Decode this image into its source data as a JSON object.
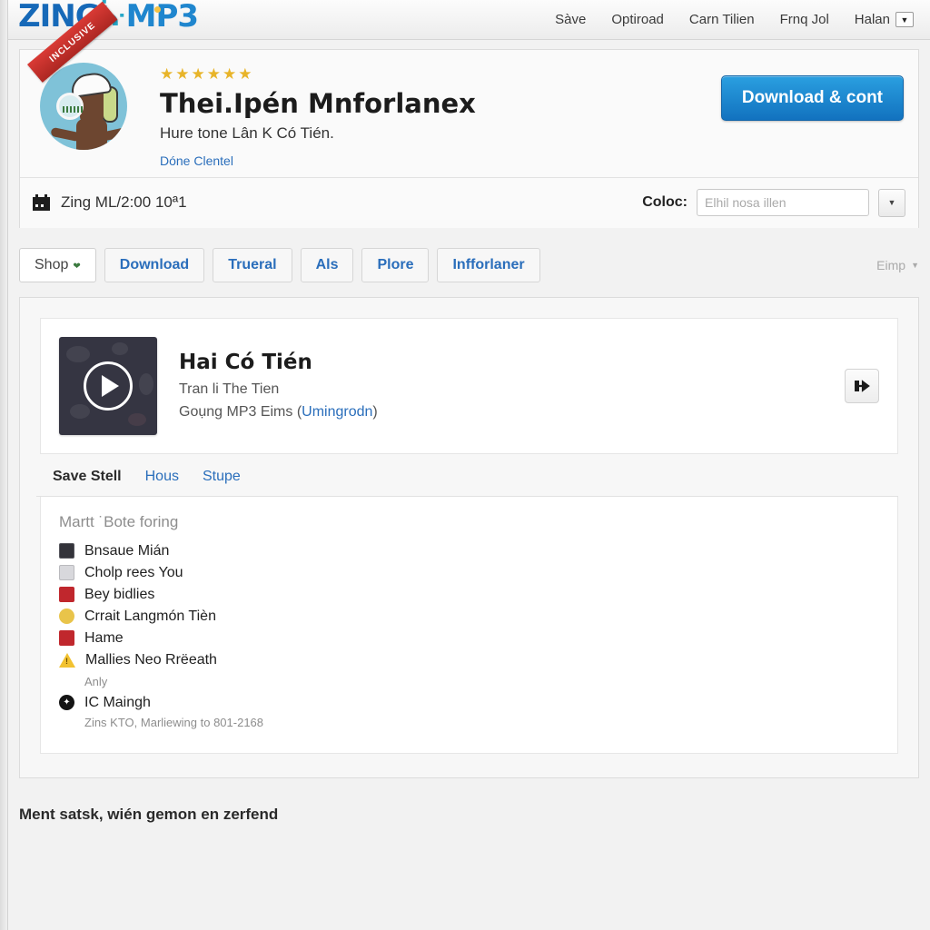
{
  "brand": {
    "part1": "ZING",
    "swoosh": "ᓾ",
    "part2": "MP3"
  },
  "topnav": {
    "items": [
      {
        "label": "Sàve"
      },
      {
        "label": "Optiroad"
      },
      {
        "label": "Carn Tilien"
      },
      {
        "label": "Frnq Jol"
      },
      {
        "label": "Halan"
      }
    ],
    "caret": "▼"
  },
  "hero": {
    "ribbon_label": "INCLUSIVE",
    "stars": "★★★★★★",
    "title": "Thei.Ipén Mnforlanex",
    "subtitle": "Hure tone Lân K Có Tién.",
    "link": "Dóne Clentel",
    "download_button": "Download & cont",
    "bar_text": "Zing ML/2:00 10ª1",
    "coloc_label": "Coloc:",
    "coloc_placeholder": "Elhil nosa illen",
    "coloc_value": "",
    "coloc_caret": "▼"
  },
  "tabs": {
    "items": [
      {
        "label": "Shop",
        "caret": "❤",
        "active": true
      },
      {
        "label": "Download",
        "active": false
      },
      {
        "label": "Trueral",
        "active": false
      },
      {
        "label": "Als",
        "active": false
      },
      {
        "label": "Plore",
        "active": false
      },
      {
        "label": "Infforlaner",
        "active": false
      }
    ],
    "right_label": "Eimp",
    "right_caret": "▼"
  },
  "song": {
    "title": "Hai Có Tién",
    "artist": "Tran li The Tien",
    "meta_prefix": "Goụng MP3 Eims (",
    "meta_link": "Umingrodn",
    "meta_suffix": ")",
    "action_icon": "sign-in-arrow"
  },
  "subtabs": [
    {
      "label": "Save Stell",
      "active": true
    },
    {
      "label": "Hous",
      "active": false
    },
    {
      "label": "Stupe",
      "active": false
    }
  ],
  "list": {
    "heading": "Martt ˙Bote foring",
    "items": [
      {
        "label": "Bnsaue Mián",
        "icon": "calculator-icon",
        "color": "#33333a"
      },
      {
        "label": "Cholp rees You",
        "icon": "disc-icon",
        "color": "#b9b9bd"
      },
      {
        "label": "Bey bidlies",
        "icon": "badge-icon",
        "color": "#c0272d"
      },
      {
        "label": "Crrait Langmón Tièn",
        "icon": "coin-icon",
        "color": "#e9c44a"
      },
      {
        "label": "Hame",
        "icon": "badge-icon",
        "color": "#c0272d"
      },
      {
        "label": "Mallies Neo Rrëeath",
        "icon": "warning-icon",
        "color": "#f2c230"
      }
    ],
    "note_1": "Anly",
    "final_item": {
      "label": "IC Maingh",
      "icon": "compass-icon",
      "glyph": "✦"
    },
    "note_2": "Zins KTO, Marliewing to 801-2168"
  },
  "footer": {
    "text": "Ment satsk, wién gemon en zerfend"
  }
}
